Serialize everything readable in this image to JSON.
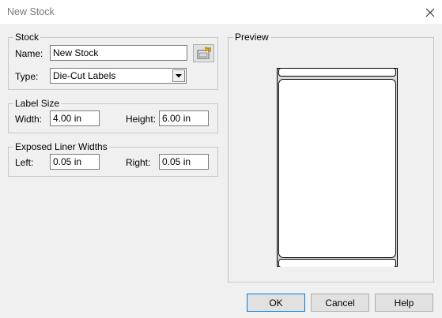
{
  "window": {
    "title": "New Stock"
  },
  "stock": {
    "group_label": "Stock",
    "name_label": "Name:",
    "name_value": "New Stock",
    "type_label": "Type:",
    "type_value": "Die-Cut Labels"
  },
  "label_size": {
    "group_label": "Label Size",
    "width_label": "Width:",
    "width_value": "4.00 in",
    "height_label": "Height:",
    "height_value": "6.00 in"
  },
  "liner": {
    "group_label": "Exposed Liner Widths",
    "left_label": "Left:",
    "left_value": "0.05 in",
    "right_label": "Right:",
    "right_value": "0.05 in"
  },
  "preview": {
    "group_label": "Preview"
  },
  "buttons": {
    "ok": "OK",
    "cancel": "Cancel",
    "help": "Help"
  },
  "icons": {
    "close": "close-icon",
    "browse": "browse-stock-icon",
    "dropdown": "chevron-down-icon"
  },
  "colors": {
    "focus_border": "#0078d7"
  }
}
